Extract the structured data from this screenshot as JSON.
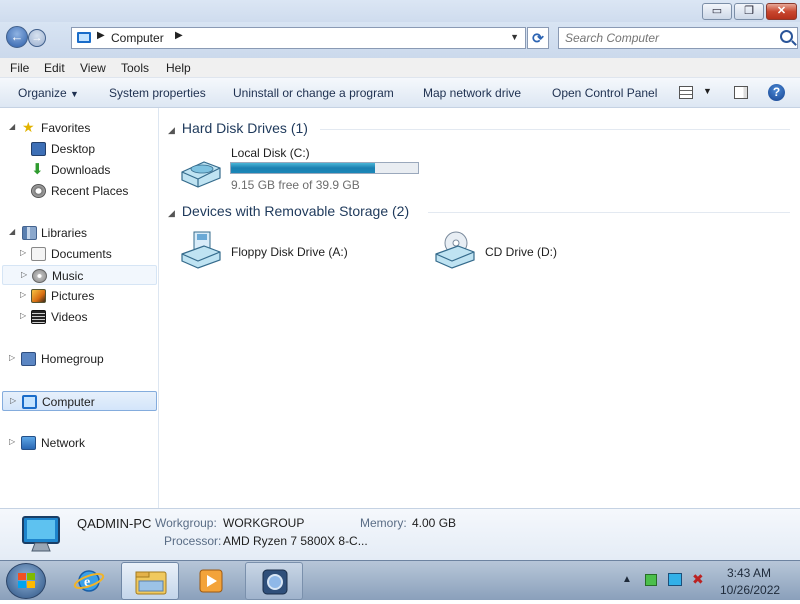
{
  "window": {
    "minimize_glyph": "▭",
    "maximize_glyph": "❐",
    "close_glyph": "✕"
  },
  "address_bar": {
    "crumb": "Computer",
    "search_placeholder": "Search Computer"
  },
  "menu": [
    "File",
    "Edit",
    "View",
    "Tools",
    "Help"
  ],
  "toolbar": {
    "organize": "Organize",
    "system_properties": "System properties",
    "uninstall": "Uninstall or change a program",
    "map_drive": "Map network drive",
    "open_control_panel": "Open Control Panel",
    "help": "?"
  },
  "nav": {
    "favorites": "Favorites",
    "desktop": "Desktop",
    "downloads": "Downloads",
    "recent_places": "Recent Places",
    "libraries": "Libraries",
    "documents": "Documents",
    "music": "Music",
    "pictures": "Pictures",
    "videos": "Videos",
    "homegroup": "Homegroup",
    "computer": "Computer",
    "network": "Network"
  },
  "content": {
    "hdd_group": "Hard Disk Drives (1)",
    "removable_group": "Devices with Removable Storage (2)",
    "local_disk": {
      "name": "Local Disk (C:)",
      "free": "9.15 GB free of 39.9 GB",
      "used_fraction": 0.77
    },
    "floppy": "Floppy Disk Drive (A:)",
    "cd": "CD Drive (D:)"
  },
  "details": {
    "pc_name": "QADMIN-PC",
    "workgroup_label": "Workgroup:",
    "workgroup": "WORKGROUP",
    "memory_label": "Memory:",
    "memory": "4.00 GB",
    "processor_label": "Processor:",
    "processor": "AMD Ryzen 7 5800X 8-C..."
  },
  "taskbar": {
    "time": "3:43 AM",
    "date": "10/26/2022"
  },
  "colors": {
    "accent": "#1e395b",
    "bar_fill": "#1b7fb0",
    "selection": "#d3e5fa"
  }
}
